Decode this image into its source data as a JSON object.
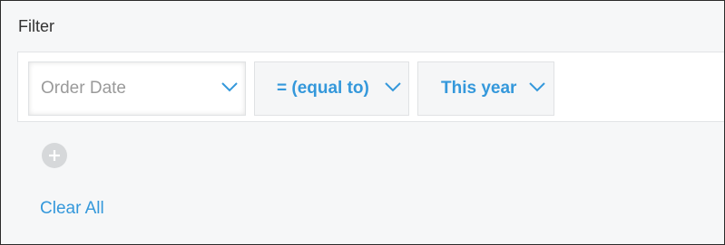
{
  "filter": {
    "title": "Filter",
    "condition": {
      "field": "Order Date",
      "operator": "= (equal to)",
      "value": "This year"
    },
    "clear_all_label": "Clear All"
  },
  "icons": {
    "dropdown": "chevron-down-icon",
    "add": "plus-icon"
  },
  "colors": {
    "accent": "#3498db",
    "placeholder_text": "#9a9a9a",
    "panel_background": "#f6f7f8"
  }
}
